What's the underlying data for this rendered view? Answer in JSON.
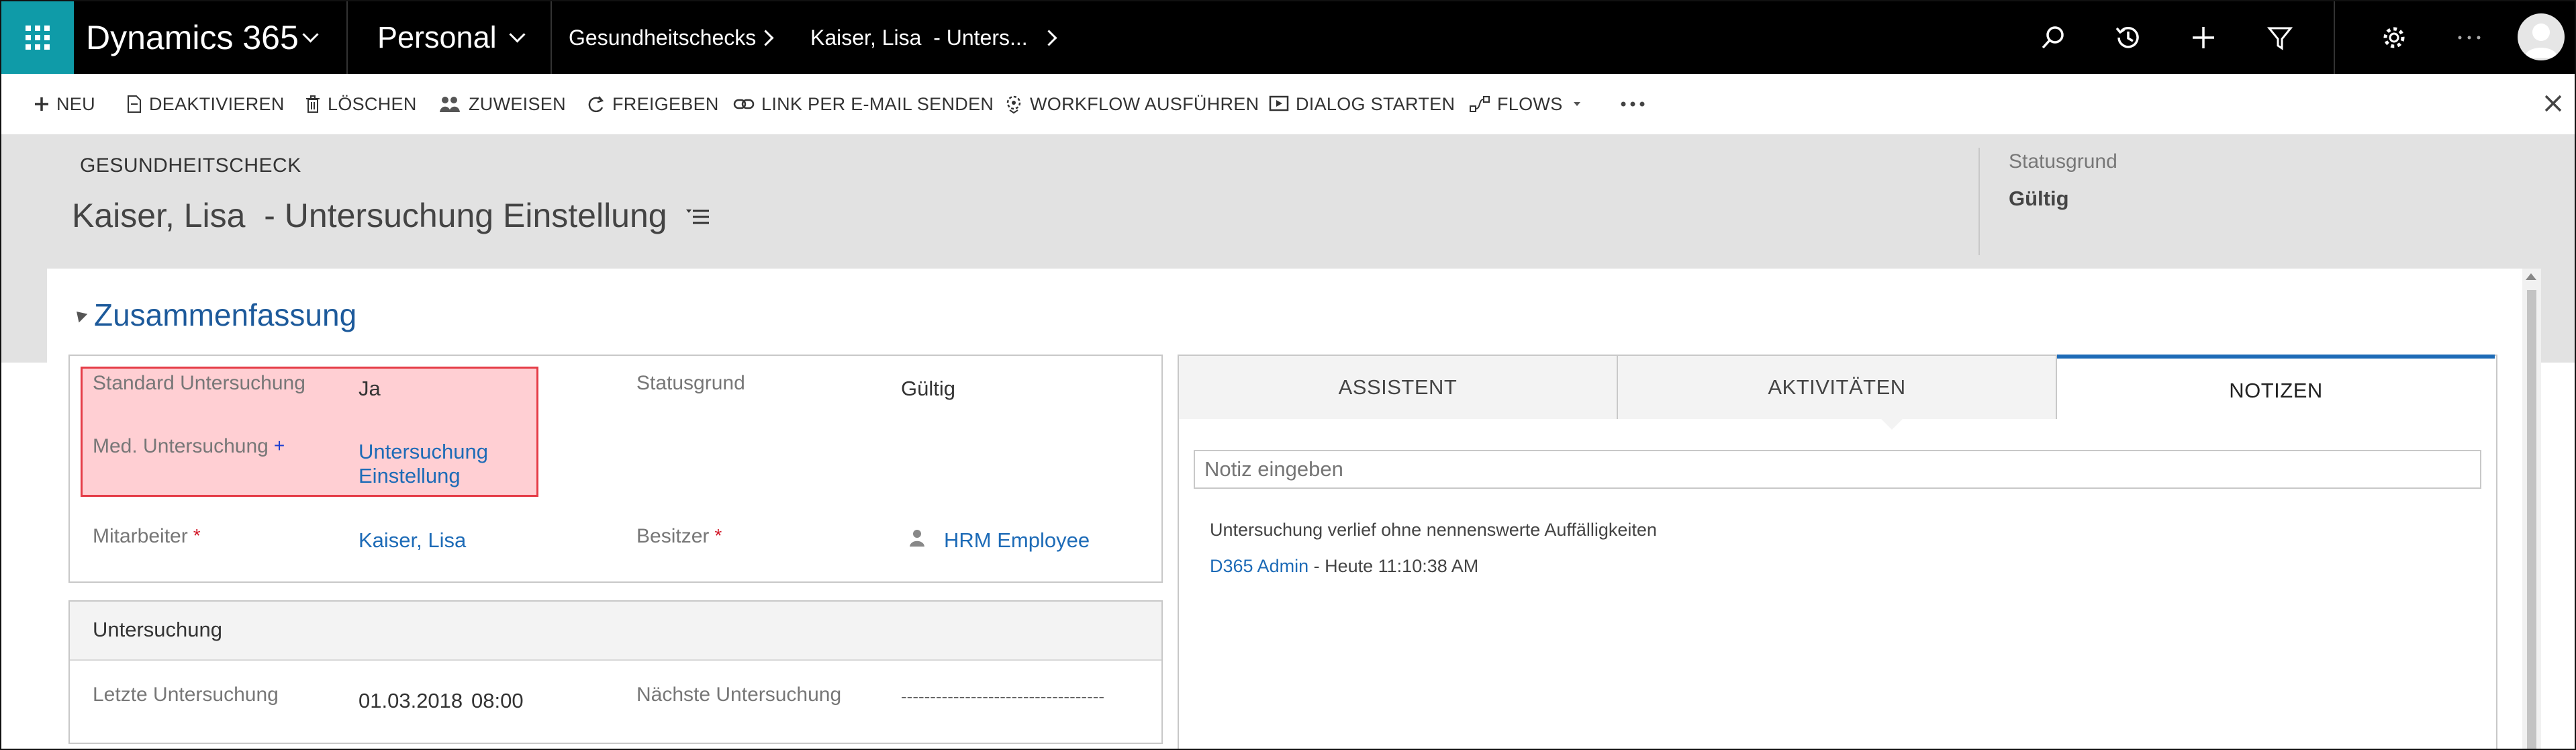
{
  "topnav": {
    "app_name": "Dynamics 365",
    "area": "Personal",
    "breadcrumb_entity": "Gesundheitschecks",
    "breadcrumb_record": "Kaiser, Lisa  - Unters..."
  },
  "commands": {
    "neu": "NEU",
    "deaktivieren": "DEAKTIVIEREN",
    "loeschen": "LÖSCHEN",
    "zuweisen": "ZUWEISEN",
    "freigeben": "FREIGEBEN",
    "link_email": "LINK PER E-MAIL SENDEN",
    "workflow": "WORKFLOW AUSFÜHREN",
    "dialog": "DIALOG STARTEN",
    "flows": "FLOWS"
  },
  "header": {
    "entity_type": "GESUNDHEITSCHECK",
    "title": "Kaiser, Lisa  - Untersuchung Einstellung",
    "status_label": "Statusgrund",
    "status_value": "Gültig"
  },
  "summary": {
    "section_title": "Zusammenfassung",
    "standard_label": "Standard Untersuchung",
    "standard_value": "Ja",
    "med_label": "Med. Untersuchung",
    "med_value_1": "Untersuchung",
    "med_value_2": "Einstellung",
    "statusgrund_label": "Statusgrund",
    "statusgrund_value": "Gültig",
    "mitarbeiter_label": "Mitarbeiter",
    "mitarbeiter_value": "Kaiser, Lisa",
    "besitzer_label": "Besitzer",
    "besitzer_value": "HRM Employee",
    "required_mark": "*",
    "recommended_mark": "+"
  },
  "examination": {
    "section_title": "Untersuchung",
    "last_label": "Letzte Untersuchung",
    "last_date": "01.03.2018",
    "last_time": "08:00",
    "next_label": "Nächste Untersuchung",
    "next_value": "-----------------------------------"
  },
  "tabs": {
    "assistent": "ASSISTENT",
    "aktivitaeten": "AKTIVITÄTEN",
    "notizen": "NOTIZEN"
  },
  "notes": {
    "placeholder": "Notiz eingeben",
    "text": "Untersuchung verlief ohne nennenswerte Auffälligkeiten",
    "author": "D365 Admin",
    "separator": " - ",
    "time": "Heute 11:10:38 AM"
  },
  "colors": {
    "waffle_bg": "#0f9ba8",
    "link": "#1d6bb7",
    "highlight_fill": "#ffcfd3",
    "highlight_border": "#e53c47"
  }
}
